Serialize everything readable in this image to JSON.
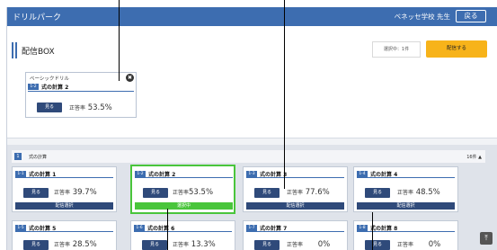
{
  "header": {
    "app_title": "ドリルパーク",
    "user_label": "ベネッセ学校 先生",
    "back_label": "戻る"
  },
  "box": {
    "title": "配信BOX",
    "selected_count": "選択中：1件",
    "deliver_label": "配信する",
    "selected_card": {
      "subtitle": "ベーシックドリル",
      "close_symbol": "✖",
      "num": "1-2",
      "title": "式の計算 2",
      "view_label": "見る",
      "score_label": "正答率",
      "score_value": "53.5%"
    }
  },
  "list": {
    "section_num": "1",
    "section_name": "式の計算",
    "section_count": "16件 ▲",
    "cards": [
      {
        "num": "1-1",
        "title": "式の計算 1",
        "view_label": "見る",
        "score_label": "正答率",
        "score_value": "39.7%",
        "select_label": "配信選択"
      },
      {
        "num": "1-2",
        "title": "式の計算 2",
        "view_label": "見る",
        "score_label": "正答率",
        "score_value": "53.5%",
        "select_label": "選択中"
      },
      {
        "num": "1-3",
        "title": "式の計算 3",
        "view_label": "見る",
        "score_label": "正答率",
        "score_value": "77.6%",
        "select_label": "配信選択"
      },
      {
        "num": "1-4",
        "title": "式の計算 4",
        "view_label": "見る",
        "score_label": "正答率",
        "score_value": "48.5%",
        "select_label": "配信選択"
      },
      {
        "num": "1-5",
        "title": "式の計算 5",
        "view_label": "見る",
        "score_label": "正答率",
        "score_value": "28.5%"
      },
      {
        "num": "1-6",
        "title": "式の計算 6",
        "view_label": "見る",
        "score_label": "正答率",
        "score_value": "13.3%"
      },
      {
        "num": "1-7",
        "title": "式の計算 7",
        "view_label": "見る",
        "score_label": "正答率",
        "score_value": "0%"
      },
      {
        "num": "1-8",
        "title": "式の計算 8",
        "view_label": "見る",
        "score_label": "正答率",
        "score_value": "0%"
      }
    ],
    "scroll_top_symbol": "⤒"
  }
}
